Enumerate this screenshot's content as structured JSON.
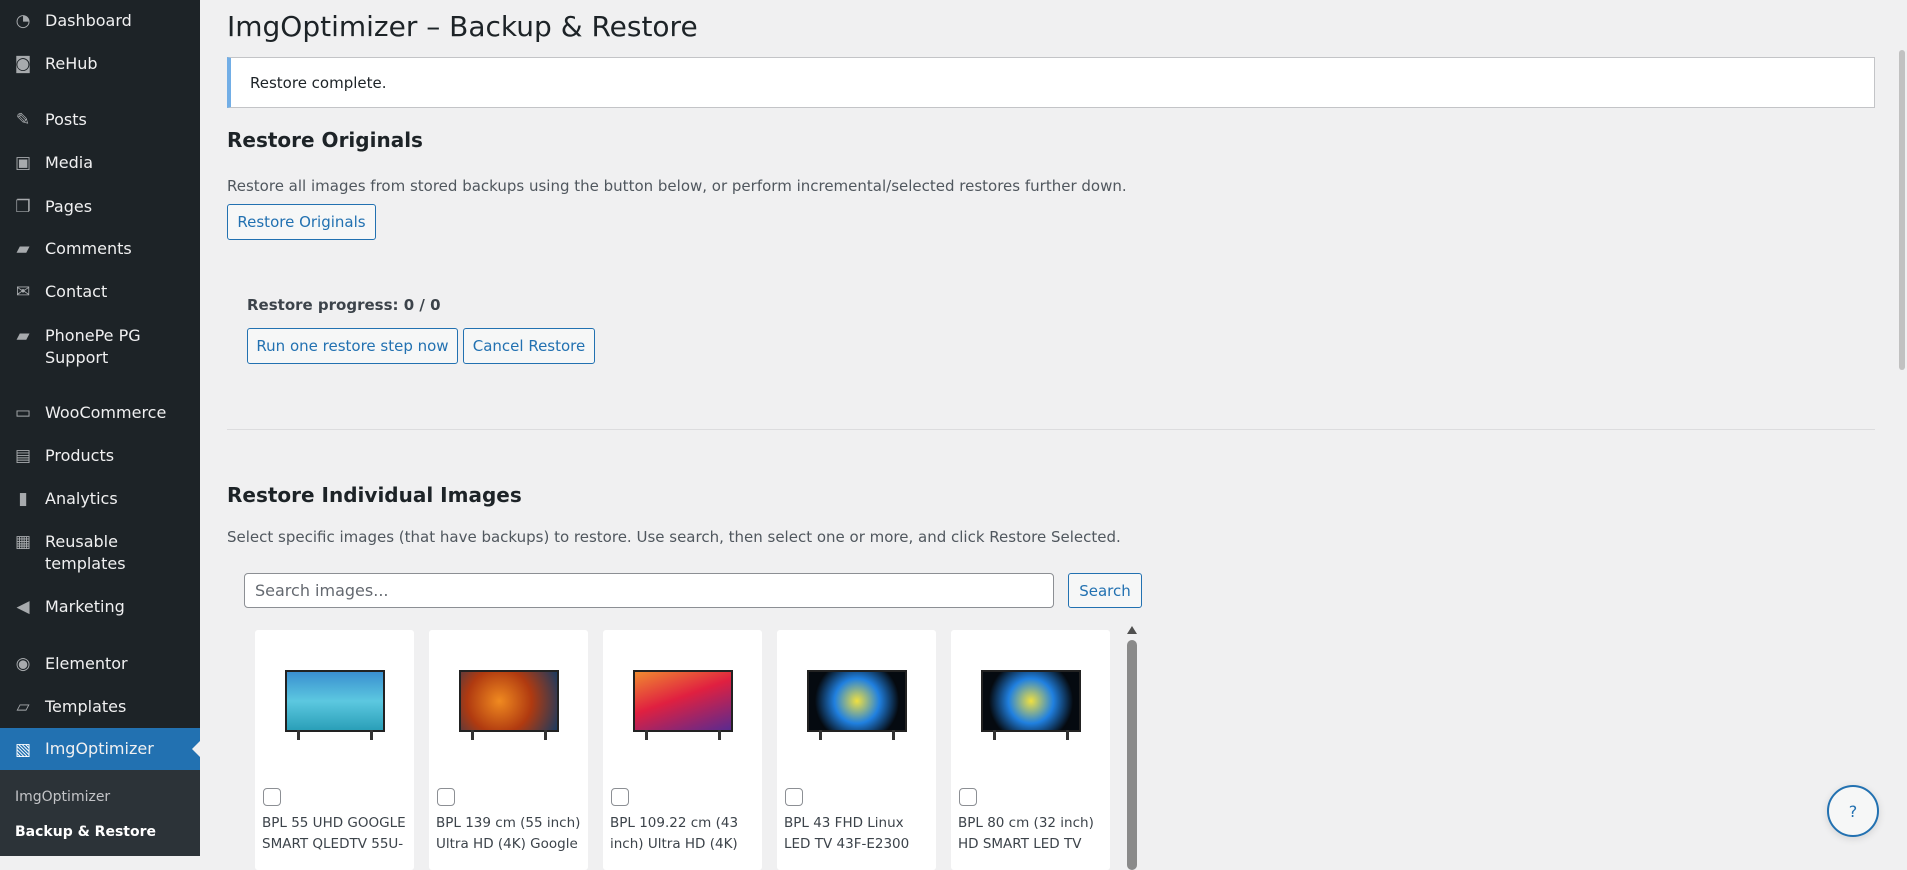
{
  "sidebar": {
    "items": [
      {
        "label": "Dashboard",
        "icon": "dashboard-icon"
      },
      {
        "label": "ReHub",
        "icon": "rehub-icon"
      },
      {
        "label": "Posts",
        "icon": "pin-icon"
      },
      {
        "label": "Media",
        "icon": "media-icon"
      },
      {
        "label": "Pages",
        "icon": "pages-icon"
      },
      {
        "label": "Comments",
        "icon": "comment-icon"
      },
      {
        "label": "Contact",
        "icon": "mail-icon"
      },
      {
        "label": "PhonePe PG Support",
        "icon": "chat-icon"
      },
      {
        "label": "WooCommerce",
        "icon": "woo-icon"
      },
      {
        "label": "Products",
        "icon": "archive-icon"
      },
      {
        "label": "Analytics",
        "icon": "bar-chart-icon"
      },
      {
        "label": "Reusable templates",
        "icon": "grid-icon"
      },
      {
        "label": "Marketing",
        "icon": "megaphone-icon"
      },
      {
        "label": "Elementor",
        "icon": "elementor-icon"
      },
      {
        "label": "Templates",
        "icon": "folder-icon"
      },
      {
        "label": "ImgOptimizer",
        "icon": "images-icon"
      }
    ],
    "submenu": [
      "ImgOptimizer",
      "Backup & Restore"
    ]
  },
  "page": {
    "title": "ImgOptimizer – Backup & Restore",
    "notice": "Restore complete."
  },
  "originals": {
    "heading": "Restore Originals",
    "description": "Restore all images from stored backups using the button below, or perform incremental/selected restores further down.",
    "button": "Restore Originals",
    "progress": "Restore progress: 0 / 0",
    "run_step": "Run one restore step now",
    "cancel": "Cancel Restore"
  },
  "individual": {
    "heading": "Restore Individual Images",
    "description": "Select specific images (that have backups) to restore. Use search, then select one or more, and click Restore Selected.",
    "search_placeholder": "Search images...",
    "search_button": "Search",
    "images": [
      {
        "title": "BPL 55 UHD GOOGLE SMART QLEDTV 55U-"
      },
      {
        "title": "BPL 139 cm (55 inch) Ultra HD (4K) Google"
      },
      {
        "title": "BPL 109.22 cm (43 inch) Ultra HD (4K)"
      },
      {
        "title": "BPL 43 FHD Linux LED TV 43F-E2300"
      },
      {
        "title": "BPL 80 cm (32 inch) HD SMART LED TV"
      }
    ]
  },
  "help": {
    "label": "?"
  }
}
